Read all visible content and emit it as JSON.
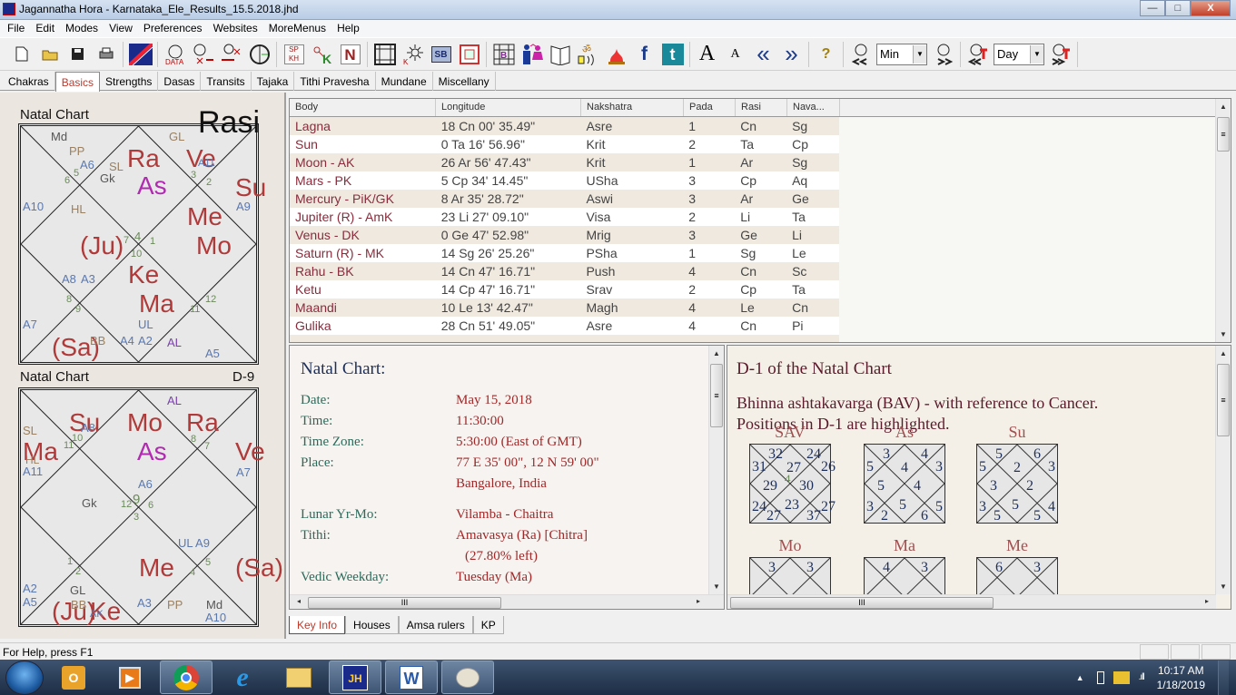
{
  "window": {
    "title": "Jagannatha Hora - Karnataka_Ele_Results_15.5.2018.jhd",
    "minimize": "—",
    "maximize": "□",
    "close": "X"
  },
  "menubar": [
    "File",
    "Edit",
    "Modes",
    "View",
    "Preferences",
    "Websites",
    "MoreMenus",
    "Help"
  ],
  "toolbar": {
    "icons": [
      "new-file-icon",
      "open-folder-icon",
      "save-icon",
      "print-icon",
      "jh-logo-icon",
      "data-clock-icon",
      "clock-back-icon",
      "clock-forward-icon",
      "half-time-icon",
      "sp-kh-icon",
      "key-k-icon",
      "n-icon",
      "grid-chart-icon",
      "kt-sun-icon",
      "sb-icon",
      "k-box-icon",
      "b-grid-icon",
      "couple-icon",
      "book-icon",
      "om-speaker-icon",
      "fire-icon",
      "facebook-icon",
      "twitter-icon",
      "font-larger-icon",
      "font-smaller-icon",
      "prev-icon",
      "next-icon",
      "help-icon"
    ],
    "sp_kh": "SP KH",
    "sb": "SB",
    "n": "N",
    "font_large": "A",
    "font_small": "A",
    "prev": "«",
    "next": "»",
    "help": "?",
    "step1_value": "Min",
    "step2_value": "Day"
  },
  "main_tabs": [
    {
      "label": "Chakras",
      "active": false
    },
    {
      "label": "Basics",
      "active": true
    },
    {
      "label": "Strengths",
      "active": false
    },
    {
      "label": "Dasas",
      "active": false
    },
    {
      "label": "Transits",
      "active": false
    },
    {
      "label": "Tajaka",
      "active": false
    },
    {
      "label": "Tithi Pravesha",
      "active": false
    },
    {
      "label": "Mundane",
      "active": false
    },
    {
      "label": "Miscellany",
      "active": false
    }
  ],
  "rasi_chart": {
    "label": "Natal Chart",
    "type": "Rasi",
    "planets": [
      "Ra",
      "As",
      "Ve",
      "Su",
      "Me",
      "Mo",
      "(Ju)",
      "Ke",
      "Ma",
      "(Sa)"
    ],
    "special": [
      "Md",
      "PP",
      "A6",
      "SL",
      "Gk",
      "GL",
      "A11",
      "A10",
      "HL",
      "A9",
      "A8",
      "A3",
      "A7",
      "BB",
      "A4",
      "A2",
      "UL",
      "AL",
      "A5"
    ],
    "house_numbers": [
      "6",
      "5",
      "3",
      "2",
      "4",
      "7",
      "1",
      "10",
      "8",
      "9",
      "12",
      "11"
    ]
  },
  "navamsa_chart": {
    "label": "Natal Chart",
    "type": "D-9",
    "planets": [
      "Su",
      "Mo",
      "Ra",
      "Ma",
      "As",
      "Ve",
      "Me",
      "(Sa)",
      "(Ju)",
      "Ke"
    ],
    "special": [
      "AL",
      "SL",
      "A8",
      "HL",
      "A11",
      "A7",
      "A6",
      "Gk",
      "UL A9",
      "A2",
      "A5",
      "GL",
      "BB",
      "AK",
      "A3",
      "PP",
      "Md",
      "A10"
    ],
    "house_numbers": [
      "11",
      "10",
      "8",
      "7",
      "12",
      "9",
      "6",
      "3",
      "1",
      "2",
      "5",
      "4"
    ]
  },
  "positions_table": {
    "columns": [
      "Body",
      "Longitude",
      "Nakshatra",
      "Pada",
      "Rasi",
      "Nava..."
    ],
    "rows": [
      [
        "Lagna",
        "18 Cn 00' 35.49\"",
        "Asre",
        "1",
        "Cn",
        "Sg"
      ],
      [
        "Sun",
        "0 Ta 16' 56.96\"",
        "Krit",
        "2",
        "Ta",
        "Cp"
      ],
      [
        "Moon - AK",
        "26 Ar 56' 47.43\"",
        "Krit",
        "1",
        "Ar",
        "Sg"
      ],
      [
        "Mars - PK",
        "5 Cp 34' 14.45\"",
        "USha",
        "3",
        "Cp",
        "Aq"
      ],
      [
        "Mercury - PiK/GK",
        "8 Ar 35' 28.72\"",
        "Aswi",
        "3",
        "Ar",
        "Ge"
      ],
      [
        "Jupiter (R) - AmK",
        "23 Li 27' 09.10\"",
        "Visa",
        "2",
        "Li",
        "Ta"
      ],
      [
        "Venus - DK",
        "0 Ge 47' 52.98\"",
        "Mrig",
        "3",
        "Ge",
        "Li"
      ],
      [
        "Saturn (R) - MK",
        "14 Sg 26' 25.26\"",
        "PSha",
        "1",
        "Sg",
        "Le"
      ],
      [
        "Rahu - BK",
        "14 Cn 47' 16.71\"",
        "Push",
        "4",
        "Cn",
        "Sc"
      ],
      [
        "Ketu",
        "14 Cp 47' 16.71\"",
        "Srav",
        "2",
        "Cp",
        "Ta"
      ],
      [
        "Maandi",
        "10 Le 13' 42.47\"",
        "Magh",
        "4",
        "Le",
        "Cn"
      ],
      [
        "Gulika",
        "28 Cn 51' 49.05\"",
        "Asre",
        "4",
        "Cn",
        "Pi"
      ]
    ]
  },
  "key_info": {
    "title": "Natal Chart:",
    "rows": [
      {
        "label": "Date:",
        "value": "May 15, 2018"
      },
      {
        "label": "Time:",
        "value": "11:30:00"
      },
      {
        "label": "Time Zone:",
        "value": "5:30:00 (East of GMT)"
      },
      {
        "label": "Place:",
        "value": "77 E 35' 00\", 12 N 59' 00\""
      },
      {
        "label": "",
        "value": "Bangalore, India"
      },
      {
        "label": "Lunar Yr-Mo:",
        "value": "Vilamba - Chaitra"
      },
      {
        "label": "Tithi:",
        "value": "Amavasya (Ra) [Chitra]"
      },
      {
        "label": "",
        "value": "(27.80% left)"
      },
      {
        "label": "Vedic Weekday:",
        "value": "Tuesday (Ma)"
      }
    ]
  },
  "bav": {
    "title": "D-1 of the Natal Chart",
    "desc1": "Bhinna ashtakavarga (BAV) - with reference to Cancer.",
    "desc2": "Positions in D-1 are highlighted.",
    "charts": [
      {
        "label": "SAV",
        "values": [
          "32",
          "24",
          "31",
          "27",
          "26",
          "29",
          "30",
          "24",
          "23",
          "27",
          "27",
          "37"
        ],
        "center": "4"
      },
      {
        "label": "As",
        "values": [
          "3",
          "4",
          "5",
          "4",
          "3",
          "5",
          "4",
          "3",
          "5",
          "5",
          "2",
          "6"
        ]
      },
      {
        "label": "Su",
        "values": [
          "5",
          "6",
          "5",
          "2",
          "3",
          "3",
          "2",
          "3",
          "5",
          "4",
          "5",
          "5"
        ]
      },
      {
        "label": "Mo",
        "values": [
          "3",
          "3"
        ]
      },
      {
        "label": "Ma",
        "values": [
          "4",
          "3"
        ]
      },
      {
        "label": "Me",
        "values": [
          "6",
          "3"
        ]
      }
    ]
  },
  "bottom_tabs": [
    {
      "label": "Key Info",
      "active": true
    },
    {
      "label": "Houses",
      "active": false
    },
    {
      "label": "Amsa rulers",
      "active": false
    },
    {
      "label": "KP",
      "active": false
    }
  ],
  "status": {
    "text": "For Help, press F1"
  },
  "taskbar": {
    "apps": [
      "outlook-icon",
      "media-player-icon",
      "chrome-icon",
      "ie-icon",
      "explorer-icon",
      "jhora-icon",
      "word-icon",
      "paint-icon"
    ],
    "time": "10:17 AM",
    "date": "1/18/2019"
  }
}
